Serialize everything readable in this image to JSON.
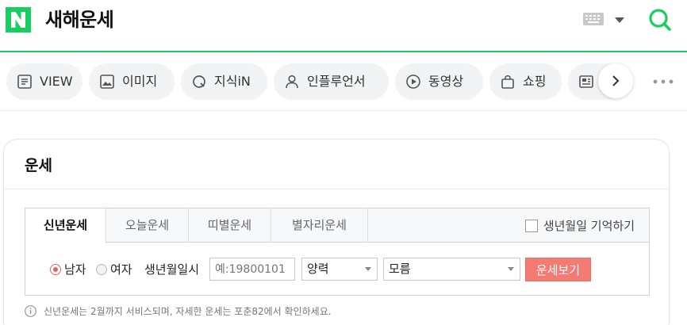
{
  "header": {
    "logo_letter": "N",
    "search_query": "새해운세"
  },
  "tabs": [
    {
      "label": "VIEW",
      "icon": "document-icon"
    },
    {
      "label": "이미지",
      "icon": "image-icon"
    },
    {
      "label": "지식iN",
      "icon": "q-icon"
    },
    {
      "label": "인플루언서",
      "icon": "person-icon"
    },
    {
      "label": "동영상",
      "icon": "play-icon"
    },
    {
      "label": "쇼핑",
      "icon": "bag-icon"
    },
    {
      "label": "",
      "icon": "news-icon"
    }
  ],
  "card": {
    "title": "운세",
    "fortune_tabs": [
      {
        "label": "신년운세",
        "active": true
      },
      {
        "label": "오늘운세",
        "active": false
      },
      {
        "label": "띠별운세",
        "active": false
      },
      {
        "label": "별자리운세",
        "active": false
      }
    ],
    "remember_label": "생년월일 기억하기",
    "gender": {
      "male": "남자",
      "female": "여자",
      "selected": "남자"
    },
    "birth_label": "생년월일시",
    "birth_placeholder": "예:19800101",
    "calendar_select": "양력",
    "time_select": "모름",
    "submit_label": "운세보기",
    "notice": "신년운세는 2월까지 서비스되며, 자세한 운세는 포춘82에서 확인하세요."
  },
  "colors": {
    "brand_green": "#19ce60",
    "button_red": "#f47a74",
    "radio_red": "#f0605b"
  }
}
